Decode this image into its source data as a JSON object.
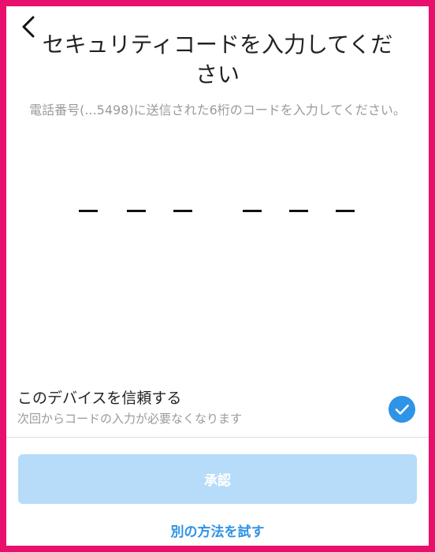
{
  "header": {
    "back_icon": "chevron-left-icon",
    "title": "セキュリティコードを入力してください",
    "subtitle": "電話番号(...5498)に送信された6桁のコードを入力してください。"
  },
  "code": {
    "digits": [
      "",
      "",
      "",
      "",
      "",
      ""
    ]
  },
  "trust_device": {
    "title": "このデバイスを信頼する",
    "subtitle": "次回からコードの入力が必要なくなります",
    "checked": true,
    "check_icon": "check-circle-icon",
    "accent_color": "#2f93e6"
  },
  "actions": {
    "approve_label": "承認",
    "other_method_label": "別の方法を試す"
  },
  "colors": {
    "frame": "#e8106c",
    "button_disabled": "#b6dcfa",
    "link": "#2f93e6"
  }
}
